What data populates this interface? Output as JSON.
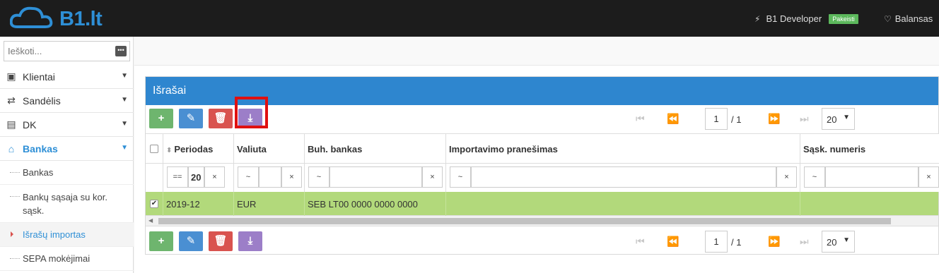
{
  "header": {
    "logo_text": "B1.lt",
    "user_name": "B1 Developer",
    "user_badge": "Pakeisti",
    "balance_label": "Balansas",
    "bolt_icon": "bolt-icon",
    "heart_icon": "heartbeat-icon"
  },
  "sidebar": {
    "search_placeholder": "Ieškoti...",
    "items": [
      {
        "label": "Klientai",
        "icon": "user-icon"
      },
      {
        "label": "Sandėlis",
        "icon": "exchange-icon"
      },
      {
        "label": "DK",
        "icon": "book-icon"
      },
      {
        "label": "Bankas",
        "icon": "bank-icon"
      }
    ],
    "subitems": [
      {
        "label": "Bankas"
      },
      {
        "label": "Bankų sąsaja su kor. sąsk."
      },
      {
        "label": "Išrašų importas"
      },
      {
        "label": "SEPA mokėjimai"
      }
    ]
  },
  "panel": {
    "title": "Išrašai",
    "pager": {
      "page": "1",
      "of": "/ 1",
      "size": "20"
    },
    "columns": [
      "Periodas",
      "Valiuta",
      "Buh. bankas",
      "Importavimo pranešimas",
      "Sąsk. numeris"
    ],
    "filters": {
      "periodas_op": "==",
      "periodas_value": "20",
      "valiuta_op": "~",
      "buh_op": "~",
      "import_op": "~",
      "sask_op": "~",
      "clear": "×"
    },
    "rows": [
      {
        "periodas": "2019-12",
        "valiuta": "EUR",
        "buh_bankas": "SEB LT00 0000 0000 0000",
        "pranesimas": "",
        "sask": ""
      }
    ]
  },
  "colors": {
    "accent": "#2e86cf",
    "selected_row": "#b2d97b",
    "add": "#6eb56e",
    "edit": "#4a8fd2",
    "delete": "#d9534f",
    "import": "#9c7ec8",
    "highlight": "#e01010"
  }
}
